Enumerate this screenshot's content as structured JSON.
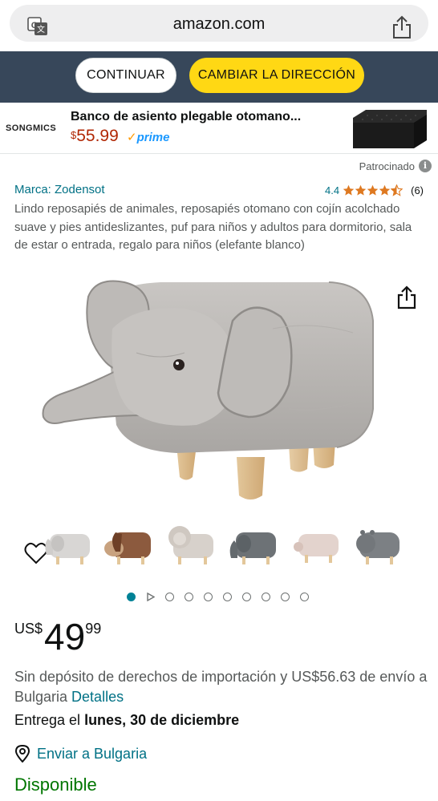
{
  "browser": {
    "url": "amazon.com",
    "translate_icon": "translate-icon",
    "share_icon": "share-icon"
  },
  "address_banner": {
    "continue_label": "CONTINUAR",
    "change_label": "CAMBIAR LA DIRECCIÓN",
    "change_color": "#ffd814",
    "bg_color": "#37475a"
  },
  "sponsored_ad": {
    "brand": "SONGMICS",
    "title": "Banco de asiento plegable otomano...",
    "price_currency": "$",
    "price_amount": "55.99",
    "prime_check": "✓",
    "prime_label": "prime",
    "sponsored_label": "Patrocinado",
    "info_icon_glyph": "i"
  },
  "product": {
    "brand_link": "Marca: Zodensot",
    "rating_value": "4.4",
    "rating_stars": 4.4,
    "rating_count": "(6)",
    "title": "Lindo reposapiés de animales, reposapiés otomano con cojín acolchado suave y pies antideslizantes, puf para niños y adultos para dormitorio, sala de estar o entrada, regalo para niños (elefante blanco)",
    "thumbnails": [
      "elephant-white",
      "dog-brown",
      "lion-beige",
      "elephant-gray",
      "pig-pink",
      "hippo-gray"
    ],
    "image_count": 10,
    "active_image_index": 0
  },
  "price": {
    "currency": "US$",
    "whole": "49",
    "fraction": "99"
  },
  "shipping": {
    "import_text": "Sin depósito de derechos de importación y US$56.63 de envío a Bulgaria ",
    "details_link": "Detalles",
    "delivery_prefix": "Entrega el ",
    "delivery_date": "lunes, 30 de diciembre",
    "ship_to": "Enviar a Bulgaria",
    "availability": "Disponible"
  },
  "colors": {
    "link": "#007185",
    "price_red": "#b12704",
    "in_stock": "#007600",
    "star": "#de7921"
  }
}
